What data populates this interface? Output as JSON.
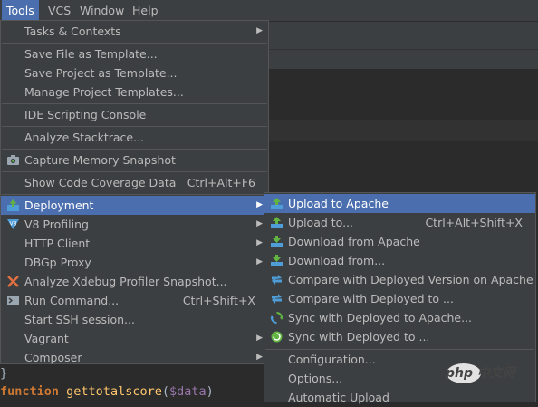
{
  "menubar": [
    "Tools",
    "VCS",
    "Window",
    "Help"
  ],
  "tools_menu": [
    {
      "label": "Tasks & Contexts",
      "arrow": true
    },
    {
      "label": "Save File as Template..."
    },
    {
      "label": "Save Project as Template..."
    },
    {
      "label": "Manage Project Templates..."
    },
    {
      "label": "IDE Scripting Console"
    },
    {
      "label": "Analyze Stacktrace..."
    },
    {
      "label": "Capture Memory Snapshot"
    },
    {
      "label": "Show Code Coverage Data",
      "shortcut": "Ctrl+Alt+F6"
    },
    {
      "label": "Deployment",
      "arrow": true,
      "highlighted": true
    },
    {
      "label": "V8 Profiling",
      "arrow": true
    },
    {
      "label": "HTTP Client",
      "arrow": true
    },
    {
      "label": "DBGp Proxy",
      "arrow": true
    },
    {
      "label": "Analyze Xdebug Profiler Snapshot..."
    },
    {
      "label": "Run Command...",
      "shortcut": "Ctrl+Shift+X"
    },
    {
      "label": "Start SSH session..."
    },
    {
      "label": "Vagrant",
      "arrow": true
    },
    {
      "label": "Composer",
      "arrow": true
    }
  ],
  "deployment_menu": [
    {
      "label": "Upload to Apache",
      "highlighted": true
    },
    {
      "label": "Upload to...",
      "shortcut": "Ctrl+Alt+Shift+X"
    },
    {
      "label": "Download from Apache"
    },
    {
      "label": "Download from..."
    },
    {
      "label": "Compare with Deployed Version on Apache"
    },
    {
      "label": "Compare with Deployed to ..."
    },
    {
      "label": "Sync with Deployed to Apache..."
    },
    {
      "label": "Sync with Deployed to ..."
    },
    {
      "label": "Configuration..."
    },
    {
      "label": "Options..."
    },
    {
      "label": "Automatic Upload"
    }
  ],
  "code": {
    "brace": "}",
    "keyword": "function",
    "fn": "gettotalscore",
    "paren_open": "(",
    "param": "$data",
    "paren_close": ")"
  },
  "watermark": "php 中文网",
  "arrow_glyph": "▶",
  "colors": {
    "accent": "#4b6eaf",
    "menu_bg": "#3c3f41",
    "editor_bg": "#2b2b2b",
    "keyword": "#cc7832",
    "fn": "#ffc66d",
    "param": "#9876aa"
  }
}
